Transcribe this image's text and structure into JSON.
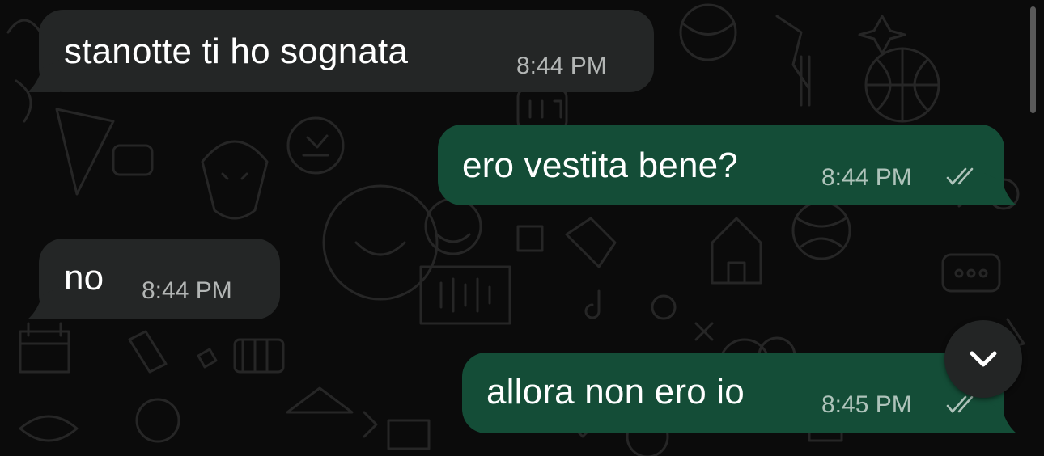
{
  "messages": [
    {
      "direction": "in",
      "text": "stanotte ti ho sognata",
      "time": "8:44 PM"
    },
    {
      "direction": "out",
      "text": "ero vestita bene?",
      "time": "8:44 PM",
      "status": "read"
    },
    {
      "direction": "in",
      "text": "no",
      "time": "8:44 PM"
    },
    {
      "direction": "out",
      "text": "allora non ero io",
      "time": "8:45 PM",
      "status": "read"
    }
  ],
  "scroll_button": {
    "icon": "chevron-down-icon"
  },
  "colors": {
    "background": "#0b0b0b",
    "incoming_bubble": "#242626",
    "outgoing_bubble": "#144d37",
    "timestamp": "#b3b6b5"
  }
}
